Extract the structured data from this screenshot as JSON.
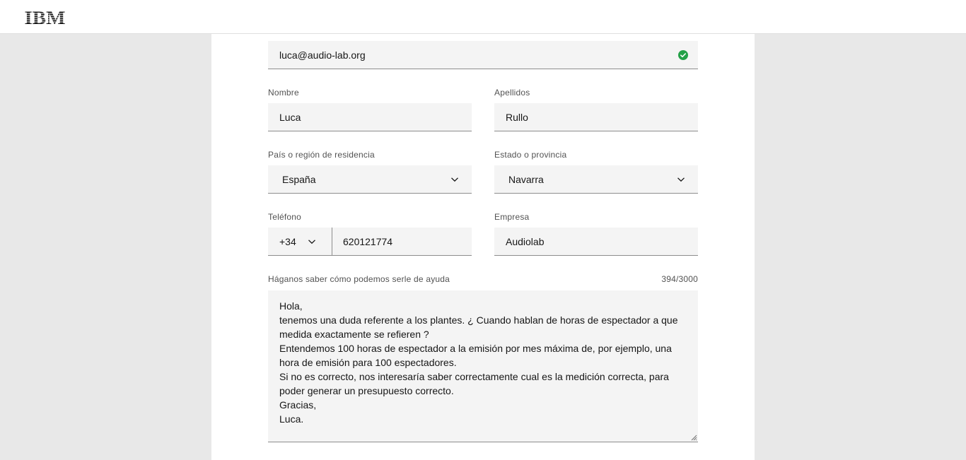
{
  "header": {
    "logo_text": "IBM"
  },
  "form": {
    "email": {
      "value": "luca@audio-lab.org",
      "status_icon": "check-circle-icon"
    },
    "first_name": {
      "label": "Nombre",
      "value": "Luca"
    },
    "last_name": {
      "label": "Apellidos",
      "value": "Rullo"
    },
    "country": {
      "label": "País o región de residencia",
      "value": "España"
    },
    "state": {
      "label": "Estado o provincia",
      "value": "Navarra"
    },
    "phone": {
      "label": "Teléfono",
      "prefix": "+34",
      "value": "620121774"
    },
    "company": {
      "label": "Empresa",
      "value": "Audiolab"
    },
    "message": {
      "label": "Háganos saber cómo podemos serle de ayuda",
      "counter": "394/3000",
      "lines": [
        "Hola,",
        "tenemos una duda referente a los plantes. ¿ Cuando hablan de horas de espectador a que",
        "medida exactamente se refieren ?",
        "Entendemos 100 horas de espectador a la emisión por mes máxima de, por ejemplo, una",
        "hora de emisión para 100 espectadores.",
        "Si no es correcto, nos interesaría saber correctamente cual es la medición correcta, para",
        "poder generar un presupuesto correcto.",
        "Gracias,",
        "Luca."
      ]
    }
  },
  "colors": {
    "success": "#24a148",
    "field_bg": "#f4f4f4",
    "page_bg": "#e8e8e8"
  }
}
